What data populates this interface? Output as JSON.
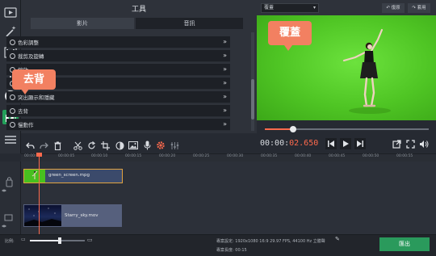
{
  "tools_panel": {
    "title": "工具",
    "tabs": [
      {
        "label": "影片",
        "active": true
      },
      {
        "label": "音訊",
        "active": false
      }
    ],
    "items": [
      {
        "label": "色彩調整"
      },
      {
        "label": "裁剪及旋轉"
      },
      {
        "label": "縮放"
      },
      {
        "label": ""
      },
      {
        "label": "突出顯示和隱藏"
      },
      {
        "label": "去背"
      },
      {
        "label": "慢動作"
      }
    ]
  },
  "preview": {
    "dropdown_value": "覆蓋",
    "undo_label": "↶ 復原",
    "redo_label": "↷ 套用"
  },
  "playback": {
    "timecode_white": "00:00:",
    "timecode_orange": "02.650",
    "seek_progress": 0.17
  },
  "ruler": {
    "labels": [
      "00:00:00",
      "00:00:05",
      "00:00:10",
      "00:00:15",
      "00:00:20",
      "00:00:25",
      "00:00:30",
      "00:00:35",
      "00:00:40",
      "00:00:45",
      "00:00:50",
      "00:00:55",
      "00:01:00"
    ]
  },
  "timeline": {
    "clips": [
      {
        "name": "green_screen.mpg"
      },
      {
        "name": "Starry_sky.mov"
      }
    ]
  },
  "status_bar": {
    "zoom_label": "比例:",
    "zoom_level": 0.55,
    "project_settings": "專案設定:  1920x1080 16:9 29.97 FPS, 44100 Hz 立體聲",
    "project_length": "專案長度:  00:15",
    "export_label": "匯出"
  },
  "callouts": {
    "remove_bg": "去背",
    "overlay": "覆蓋"
  },
  "colors": {
    "accent": "#ff6a4d",
    "callout": "#f28061",
    "export": "#2a9a5c",
    "chroma_green": "#4fc524"
  },
  "icons": {
    "left_toolbar": [
      "video-import-icon",
      "magic-wand-icon",
      "filmstrip-icon",
      "text-icon",
      "star-icon",
      "overlay-icon",
      "list-icon"
    ],
    "edit_toolbar": [
      "undo-icon",
      "redo-icon",
      "delete-icon",
      "cut-icon",
      "rotate-icon",
      "crop-icon",
      "color-icon",
      "image-icon",
      "mic-icon",
      "gear-icon",
      "equalizer-icon"
    ],
    "playback": [
      "skip-back-icon",
      "play-icon",
      "skip-forward-icon",
      "export-frame-icon",
      "fullscreen-icon",
      "volume-icon"
    ]
  }
}
